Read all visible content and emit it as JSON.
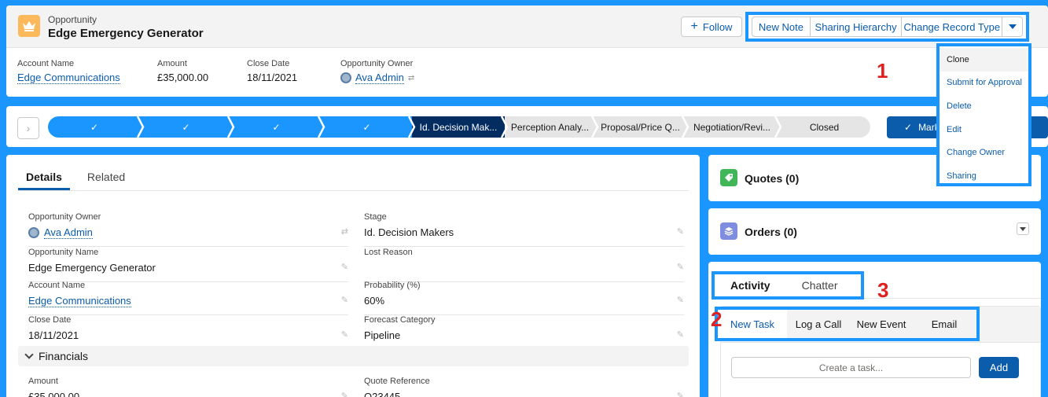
{
  "header": {
    "object_type": "Opportunity",
    "record_name": "Edge Emergency Generator",
    "follow_label": "Follow",
    "actions": [
      "New Note",
      "Sharing Hierarchy",
      "Change Record Type"
    ],
    "highlights": [
      {
        "label": "Account Name",
        "value": "Edge Communications"
      },
      {
        "label": "Amount",
        "value": "£35,000.00"
      },
      {
        "label": "Close Date",
        "value": "18/11/2021"
      },
      {
        "label": "Opportunity Owner",
        "value": "Ava Admin"
      }
    ]
  },
  "overflow_menu": [
    "Clone",
    "Submit for Approval",
    "Delete",
    "Edit",
    "Change Owner",
    "Sharing"
  ],
  "annotations": {
    "one": "1",
    "two": "2",
    "three": "3"
  },
  "path": {
    "stages": [
      {
        "label": "",
        "status": "done"
      },
      {
        "label": "",
        "status": "done"
      },
      {
        "label": "",
        "status": "done"
      },
      {
        "label": "",
        "status": "done"
      },
      {
        "label": "Id. Decision Mak...",
        "status": "current"
      },
      {
        "label": "Perception Analy...",
        "status": "todo"
      },
      {
        "label": "Proposal/Price Q...",
        "status": "todo"
      },
      {
        "label": "Negotiation/Revi...",
        "status": "todo"
      },
      {
        "label": "Closed",
        "status": "todo"
      }
    ],
    "mark_label": "Mark"
  },
  "details": {
    "tabs": [
      "Details",
      "Related"
    ],
    "fields_left": [
      {
        "label": "Opportunity Owner",
        "value": "Ava Admin"
      },
      {
        "label": "Opportunity Name",
        "value": "Edge Emergency Generator"
      },
      {
        "label": "Account Name",
        "value": "Edge Communications"
      },
      {
        "label": "Close Date",
        "value": "18/11/2021"
      }
    ],
    "fields_right": [
      {
        "label": "Stage",
        "value": "Id. Decision Makers"
      },
      {
        "label": "Lost Reason",
        "value": ""
      },
      {
        "label": "Probability (%)",
        "value": "60%"
      },
      {
        "label": "Forecast Category",
        "value": "Pipeline"
      }
    ],
    "section_title": "Financials",
    "financials": [
      {
        "label": "Amount",
        "value": "£35,000.00"
      },
      {
        "label": "Quote Reference",
        "value": "Q23445"
      }
    ]
  },
  "side": {
    "quotes_title": "Quotes (0)",
    "orders_title": "Orders (0)",
    "activity_tabs": [
      "Activity",
      "Chatter"
    ],
    "publisher_tabs": [
      "New Task",
      "Log a Call",
      "New Event",
      "Email"
    ],
    "task_placeholder": "Create a task...",
    "add_label": "Add"
  },
  "colors": {
    "brand": "#1b96ff",
    "accent": "#0b5cab",
    "path_current": "#032d60",
    "annotation": "#e02020"
  }
}
